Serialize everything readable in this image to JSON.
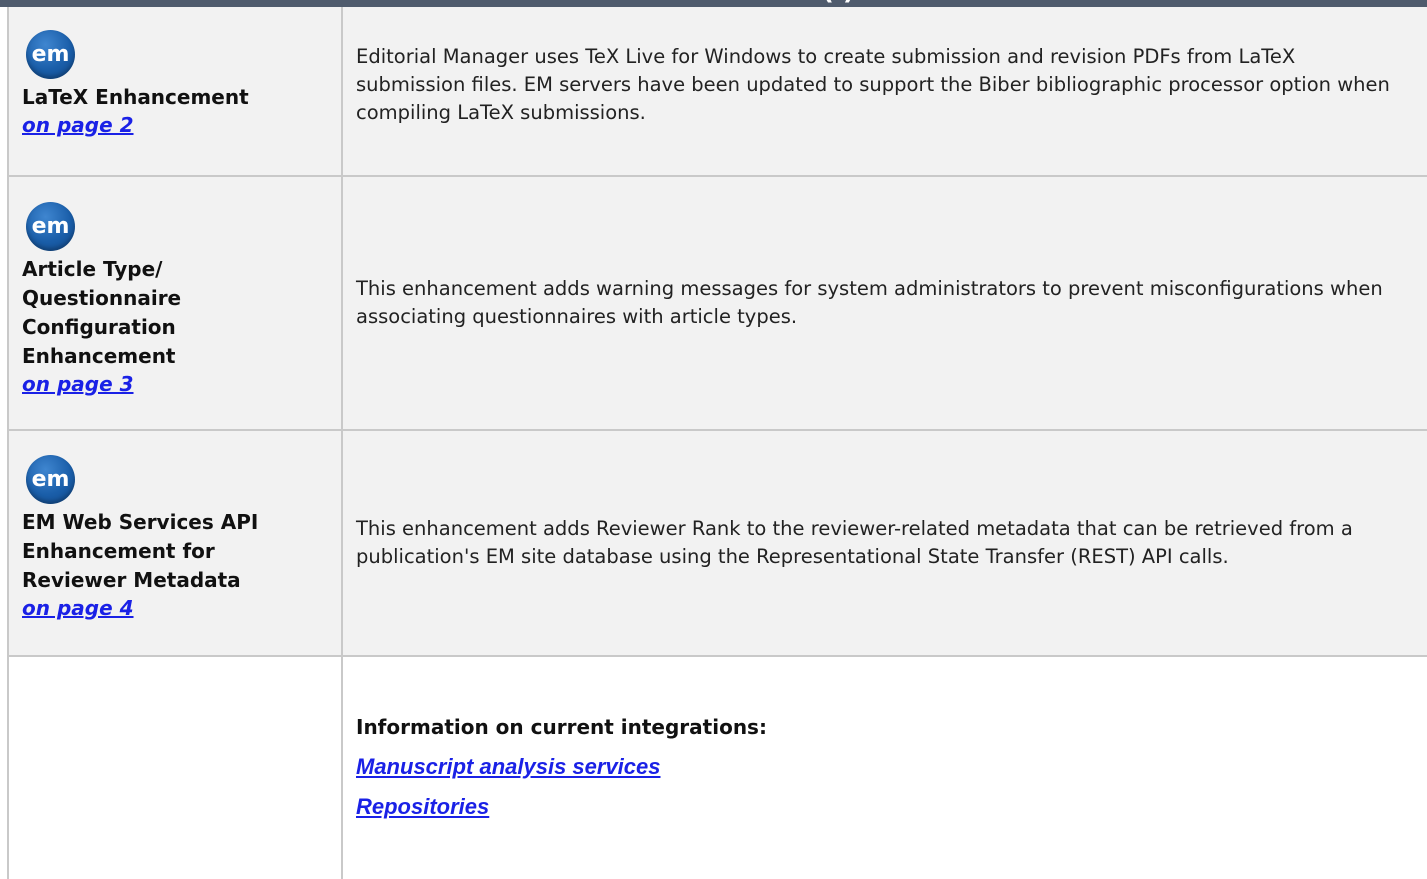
{
  "header": {
    "partial_text": "(              )"
  },
  "rows": [
    {
      "logo": "em",
      "title": "LaTeX Enhancement",
      "link": "on page 2",
      "description": "Editorial Manager uses TeX Live for Windows to create submission and revision PDFs from LaTeX submission files. EM servers have been updated to support the Biber bibliographic processor option when compiling LaTeX submissions."
    },
    {
      "logo": "em",
      "title": "Article Type/ Questionnaire Configuration Enhancement",
      "link": "on page 3",
      "description": "This enhancement adds warning messages for system administrators to prevent misconfigurations when associating questionnaires with article types."
    },
    {
      "logo": "em",
      "title": "EM Web Services API Enhancement for Reviewer Metadata",
      "link": "on page 4",
      "description": "This enhancement adds Reviewer Rank to the reviewer-related metadata that can be retrieved from a publication's EM site database using the Representational State Transfer (REST) API calls."
    }
  ],
  "integrations": {
    "title": "Information on current integrations:",
    "links": [
      "Manuscript analysis services",
      "Repositories"
    ]
  },
  "colors": {
    "header_bar": "#4f5b6d",
    "row_shade": "#f2f2f2",
    "link": "#1a21e6",
    "border": "#c9c9c9"
  }
}
